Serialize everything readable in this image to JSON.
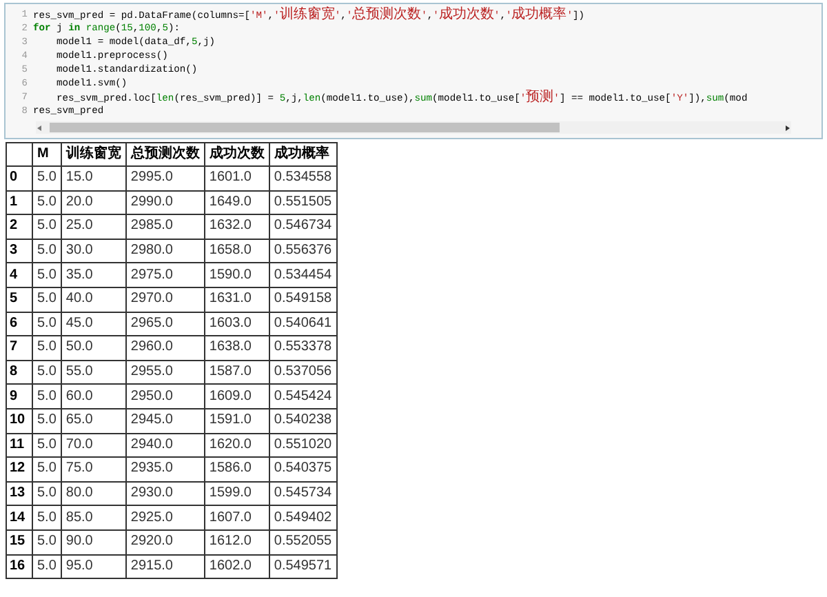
{
  "code_cell": {
    "lines": [
      {
        "number": "1",
        "tokens": [
          {
            "kind": "plain",
            "text": "res_svm_pred = pd.DataFrame(columns=["
          },
          {
            "kind": "string",
            "text": "'M'"
          },
          {
            "kind": "plain",
            "text": ","
          },
          {
            "kind": "string",
            "text": "'训练窗宽'"
          },
          {
            "kind": "plain",
            "text": ","
          },
          {
            "kind": "string",
            "text": "'总预测次数'"
          },
          {
            "kind": "plain",
            "text": ","
          },
          {
            "kind": "string",
            "text": "'成功次数'"
          },
          {
            "kind": "plain",
            "text": ","
          },
          {
            "kind": "string",
            "text": "'成功概率'"
          },
          {
            "kind": "plain",
            "text": "])"
          }
        ]
      },
      {
        "number": "2",
        "tokens": [
          {
            "kind": "keyword",
            "text": "for"
          },
          {
            "kind": "plain",
            "text": " j "
          },
          {
            "kind": "keyword",
            "text": "in"
          },
          {
            "kind": "builtin",
            "text": " range"
          },
          {
            "kind": "plain",
            "text": "("
          },
          {
            "kind": "number",
            "text": "15"
          },
          {
            "kind": "plain",
            "text": ","
          },
          {
            "kind": "number",
            "text": "100"
          },
          {
            "kind": "plain",
            "text": ","
          },
          {
            "kind": "number",
            "text": "5"
          },
          {
            "kind": "plain",
            "text": "):"
          }
        ]
      },
      {
        "number": "3",
        "tokens": [
          {
            "kind": "plain",
            "text": "    model1 = model(data_df,"
          },
          {
            "kind": "number",
            "text": "5"
          },
          {
            "kind": "plain",
            "text": ",j)"
          }
        ]
      },
      {
        "number": "4",
        "tokens": [
          {
            "kind": "plain",
            "text": "    model1.preprocess()"
          }
        ]
      },
      {
        "number": "5",
        "tokens": [
          {
            "kind": "plain",
            "text": "    model1.standardization()"
          }
        ]
      },
      {
        "number": "6",
        "tokens": [
          {
            "kind": "plain",
            "text": "    model1.svm()"
          }
        ]
      },
      {
        "number": "7",
        "tokens": [
          {
            "kind": "plain",
            "text": "    res_svm_pred.loc["
          },
          {
            "kind": "builtin",
            "text": "len"
          },
          {
            "kind": "plain",
            "text": "(res_svm_pred)] = "
          },
          {
            "kind": "number",
            "text": "5"
          },
          {
            "kind": "plain",
            "text": ",j,"
          },
          {
            "kind": "builtin",
            "text": "len"
          },
          {
            "kind": "plain",
            "text": "(model1.to_use),"
          },
          {
            "kind": "builtin",
            "text": "sum"
          },
          {
            "kind": "plain",
            "text": "(model1.to_use["
          },
          {
            "kind": "string",
            "text": "'预测'"
          },
          {
            "kind": "plain",
            "text": "] == model1.to_use["
          },
          {
            "kind": "string",
            "text": "'Y'"
          },
          {
            "kind": "plain",
            "text": "]),"
          },
          {
            "kind": "builtin",
            "text": "sum"
          },
          {
            "kind": "plain",
            "text": "(mod"
          }
        ]
      },
      {
        "number": "8",
        "tokens": [
          {
            "kind": "plain",
            "text": "res_svm_pred"
          }
        ]
      }
    ]
  },
  "table": {
    "columns": [
      "M",
      "训练窗宽",
      "总预测次数",
      "成功次数",
      "成功概率"
    ],
    "rows": [
      {
        "index": "0",
        "cells": [
          "5.0",
          "15.0",
          "2995.0",
          "1601.0",
          "0.534558"
        ]
      },
      {
        "index": "1",
        "cells": [
          "5.0",
          "20.0",
          "2990.0",
          "1649.0",
          "0.551505"
        ]
      },
      {
        "index": "2",
        "cells": [
          "5.0",
          "25.0",
          "2985.0",
          "1632.0",
          "0.546734"
        ]
      },
      {
        "index": "3",
        "cells": [
          "5.0",
          "30.0",
          "2980.0",
          "1658.0",
          "0.556376"
        ]
      },
      {
        "index": "4",
        "cells": [
          "5.0",
          "35.0",
          "2975.0",
          "1590.0",
          "0.534454"
        ]
      },
      {
        "index": "5",
        "cells": [
          "5.0",
          "40.0",
          "2970.0",
          "1631.0",
          "0.549158"
        ]
      },
      {
        "index": "6",
        "cells": [
          "5.0",
          "45.0",
          "2965.0",
          "1603.0",
          "0.540641"
        ]
      },
      {
        "index": "7",
        "cells": [
          "5.0",
          "50.0",
          "2960.0",
          "1638.0",
          "0.553378"
        ]
      },
      {
        "index": "8",
        "cells": [
          "5.0",
          "55.0",
          "2955.0",
          "1587.0",
          "0.537056"
        ]
      },
      {
        "index": "9",
        "cells": [
          "5.0",
          "60.0",
          "2950.0",
          "1609.0",
          "0.545424"
        ]
      },
      {
        "index": "10",
        "cells": [
          "5.0",
          "65.0",
          "2945.0",
          "1591.0",
          "0.540238"
        ]
      },
      {
        "index": "11",
        "cells": [
          "5.0",
          "70.0",
          "2940.0",
          "1620.0",
          "0.551020"
        ]
      },
      {
        "index": "12",
        "cells": [
          "5.0",
          "75.0",
          "2935.0",
          "1586.0",
          "0.540375"
        ]
      },
      {
        "index": "13",
        "cells": [
          "5.0",
          "80.0",
          "2930.0",
          "1599.0",
          "0.545734"
        ]
      },
      {
        "index": "14",
        "cells": [
          "5.0",
          "85.0",
          "2925.0",
          "1607.0",
          "0.549402"
        ]
      },
      {
        "index": "15",
        "cells": [
          "5.0",
          "90.0",
          "2920.0",
          "1612.0",
          "0.552055"
        ]
      },
      {
        "index": "16",
        "cells": [
          "5.0",
          "95.0",
          "2915.0",
          "1602.0",
          "0.549571"
        ]
      }
    ]
  }
}
